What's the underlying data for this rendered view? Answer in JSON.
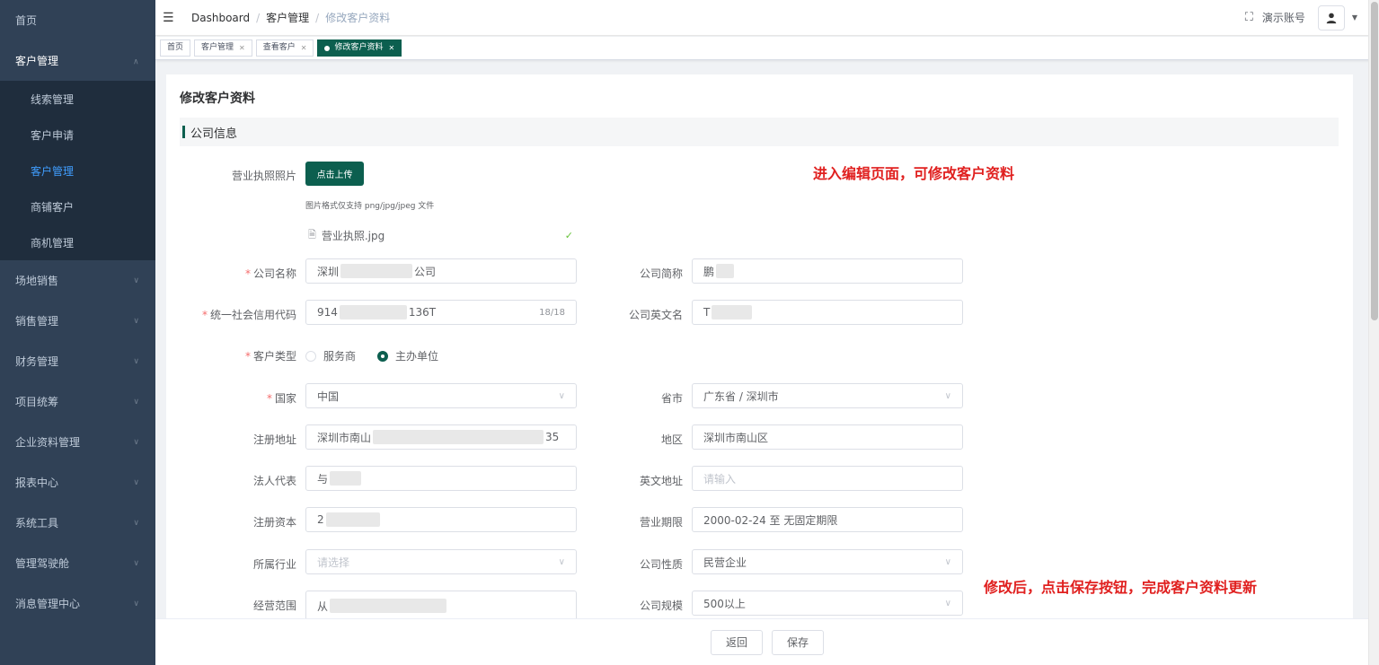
{
  "sidebar": {
    "home": "首页",
    "customer_mgmt": "客户管理",
    "sub_items": [
      "线索管理",
      "客户申请",
      "客户管理",
      "商铺客户",
      "商机管理"
    ],
    "active_sub": 2,
    "items": [
      "场地销售",
      "销售管理",
      "财务管理",
      "项目统筹",
      "企业资料管理",
      "报表中心",
      "系统工具",
      "管理驾驶舱",
      "消息管理中心"
    ]
  },
  "header": {
    "breadcrumb": [
      "Dashboard",
      "客户管理",
      "修改客户资料"
    ],
    "account": "演示账号"
  },
  "tags": {
    "home": "首页",
    "items": [
      "客户管理",
      "查看客户"
    ],
    "active": "修改客户资料"
  },
  "page": {
    "title": "修改客户资料",
    "section": "公司信息"
  },
  "form": {
    "license_label": "营业执照照片",
    "upload_label": "点击上传",
    "upload_tip": "图片格式仅支持 png/jpg/jpeg 文件",
    "file_name": "营业执照.jpg",
    "company_name_label": "公司名称",
    "company_name_a": "深圳",
    "company_name_b": "公司",
    "short_name_label": "公司简称",
    "short_name_a": "鹏",
    "credit_code_label": "统一社会信用代码",
    "credit_code_a": "914",
    "credit_code_b": "136T",
    "credit_code_count": "18/18",
    "english_name_label": "公司英文名",
    "english_name_a": "T",
    "customer_type_label": "客户类型",
    "customer_type_options": [
      "服务商",
      "主办单位"
    ],
    "country_label": "国家",
    "country": "中国",
    "province_label": "省市",
    "province": "广东省 / 深圳市",
    "reg_address_label": "注册地址",
    "reg_address_a": "深圳市南山",
    "reg_address_b": "35",
    "district_label": "地区",
    "district": "深圳市南山区",
    "legal_rep_label": "法人代表",
    "legal_rep_a": "与",
    "english_address_label": "英文地址",
    "english_address_placeholder": "请输入",
    "reg_capital_label": "注册资本",
    "reg_capital_a": "2",
    "business_term_label": "营业期限",
    "business_term": "2000-02-24 至 无固定期限",
    "industry_label": "所属行业",
    "industry_placeholder": "请选择",
    "nature_label": "公司性质",
    "nature": "民营企业",
    "scope_label": "经营范围",
    "scope_a": "从",
    "size_label": "公司规模",
    "size": "500以上"
  },
  "annotations": {
    "top": "进入编辑页面，可修改客户资料",
    "bottom": "修改后，点击保存按钮，完成客户资料更新"
  },
  "footer": {
    "back": "返回",
    "save": "保存"
  },
  "colors": {
    "sidebar_bg": "#304156",
    "primary": "#0c5f4f",
    "annotation": "#e0201f"
  }
}
